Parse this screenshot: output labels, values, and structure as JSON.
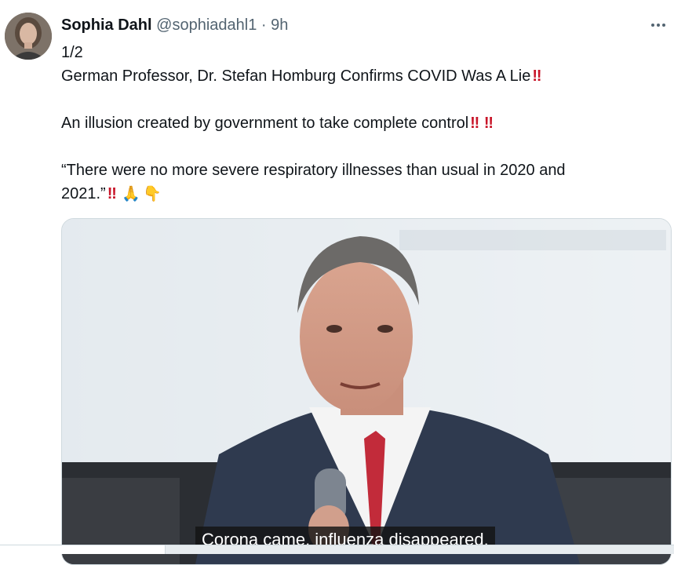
{
  "author": {
    "name": "Sophia Dahl",
    "handle": "@sophiadahl1",
    "separator": "·",
    "time": "9h"
  },
  "tweet": {
    "line1": "1/2",
    "line2": "German Professor, Dr. Stefan Homburg Confirms COVID Was A Lie",
    "line3": "An illusion created by government to take complete control",
    "line4": "“There were no more severe respiratory illnesses than usual in 2020 and",
    "line5": "2021.”",
    "emphasis": "‼",
    "emoji_hands": "🙏",
    "emoji_point": "👇"
  },
  "media": {
    "subtitle": "Corona came, influenza disappeared."
  },
  "icons": {
    "more": "more-icon"
  },
  "colors": {
    "name": "#0f1419",
    "secondary": "#536471",
    "emphasis": "#c81428"
  }
}
